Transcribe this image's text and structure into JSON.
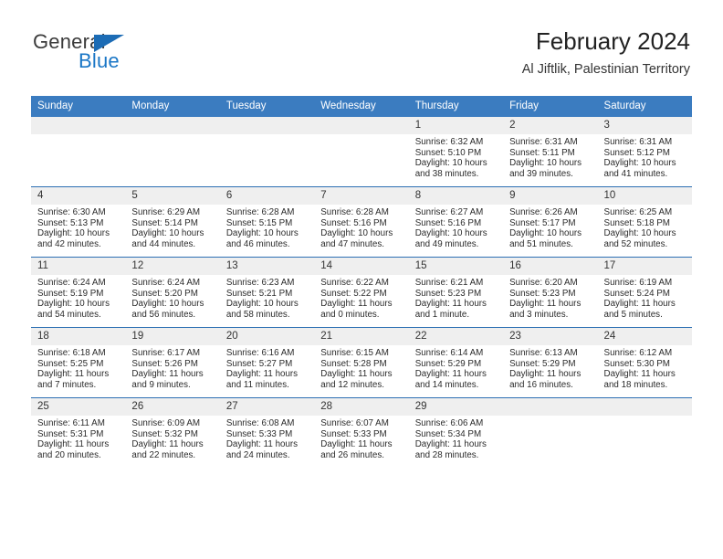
{
  "brand": {
    "name_top": "General",
    "name_bottom": "Blue",
    "color_top": "#3b3b3b",
    "color_bottom": "#1a76c6",
    "triangle_color": "#1c6cb5"
  },
  "header": {
    "title": "February 2024",
    "subtitle": "Al Jiftlik, Palestinian Territory"
  },
  "theme": {
    "header_bg": "#3b7cc0",
    "header_text": "#ffffff",
    "daynum_bg": "#efefef",
    "row_divider": "#2c6fb3"
  },
  "weekday_headers": [
    "Sunday",
    "Monday",
    "Tuesday",
    "Wednesday",
    "Thursday",
    "Friday",
    "Saturday"
  ],
  "weeks": [
    [
      {
        "day": "",
        "sunrise": "",
        "sunset": "",
        "daylight1": "",
        "daylight2": ""
      },
      {
        "day": "",
        "sunrise": "",
        "sunset": "",
        "daylight1": "",
        "daylight2": ""
      },
      {
        "day": "",
        "sunrise": "",
        "sunset": "",
        "daylight1": "",
        "daylight2": ""
      },
      {
        "day": "",
        "sunrise": "",
        "sunset": "",
        "daylight1": "",
        "daylight2": ""
      },
      {
        "day": "1",
        "sunrise": "Sunrise: 6:32 AM",
        "sunset": "Sunset: 5:10 PM",
        "daylight1": "Daylight: 10 hours",
        "daylight2": "and 38 minutes."
      },
      {
        "day": "2",
        "sunrise": "Sunrise: 6:31 AM",
        "sunset": "Sunset: 5:11 PM",
        "daylight1": "Daylight: 10 hours",
        "daylight2": "and 39 minutes."
      },
      {
        "day": "3",
        "sunrise": "Sunrise: 6:31 AM",
        "sunset": "Sunset: 5:12 PM",
        "daylight1": "Daylight: 10 hours",
        "daylight2": "and 41 minutes."
      }
    ],
    [
      {
        "day": "4",
        "sunrise": "Sunrise: 6:30 AM",
        "sunset": "Sunset: 5:13 PM",
        "daylight1": "Daylight: 10 hours",
        "daylight2": "and 42 minutes."
      },
      {
        "day": "5",
        "sunrise": "Sunrise: 6:29 AM",
        "sunset": "Sunset: 5:14 PM",
        "daylight1": "Daylight: 10 hours",
        "daylight2": "and 44 minutes."
      },
      {
        "day": "6",
        "sunrise": "Sunrise: 6:28 AM",
        "sunset": "Sunset: 5:15 PM",
        "daylight1": "Daylight: 10 hours",
        "daylight2": "and 46 minutes."
      },
      {
        "day": "7",
        "sunrise": "Sunrise: 6:28 AM",
        "sunset": "Sunset: 5:16 PM",
        "daylight1": "Daylight: 10 hours",
        "daylight2": "and 47 minutes."
      },
      {
        "day": "8",
        "sunrise": "Sunrise: 6:27 AM",
        "sunset": "Sunset: 5:16 PM",
        "daylight1": "Daylight: 10 hours",
        "daylight2": "and 49 minutes."
      },
      {
        "day": "9",
        "sunrise": "Sunrise: 6:26 AM",
        "sunset": "Sunset: 5:17 PM",
        "daylight1": "Daylight: 10 hours",
        "daylight2": "and 51 minutes."
      },
      {
        "day": "10",
        "sunrise": "Sunrise: 6:25 AM",
        "sunset": "Sunset: 5:18 PM",
        "daylight1": "Daylight: 10 hours",
        "daylight2": "and 52 minutes."
      }
    ],
    [
      {
        "day": "11",
        "sunrise": "Sunrise: 6:24 AM",
        "sunset": "Sunset: 5:19 PM",
        "daylight1": "Daylight: 10 hours",
        "daylight2": "and 54 minutes."
      },
      {
        "day": "12",
        "sunrise": "Sunrise: 6:24 AM",
        "sunset": "Sunset: 5:20 PM",
        "daylight1": "Daylight: 10 hours",
        "daylight2": "and 56 minutes."
      },
      {
        "day": "13",
        "sunrise": "Sunrise: 6:23 AM",
        "sunset": "Sunset: 5:21 PM",
        "daylight1": "Daylight: 10 hours",
        "daylight2": "and 58 minutes."
      },
      {
        "day": "14",
        "sunrise": "Sunrise: 6:22 AM",
        "sunset": "Sunset: 5:22 PM",
        "daylight1": "Daylight: 11 hours",
        "daylight2": "and 0 minutes."
      },
      {
        "day": "15",
        "sunrise": "Sunrise: 6:21 AM",
        "sunset": "Sunset: 5:23 PM",
        "daylight1": "Daylight: 11 hours",
        "daylight2": "and 1 minute."
      },
      {
        "day": "16",
        "sunrise": "Sunrise: 6:20 AM",
        "sunset": "Sunset: 5:23 PM",
        "daylight1": "Daylight: 11 hours",
        "daylight2": "and 3 minutes."
      },
      {
        "day": "17",
        "sunrise": "Sunrise: 6:19 AM",
        "sunset": "Sunset: 5:24 PM",
        "daylight1": "Daylight: 11 hours",
        "daylight2": "and 5 minutes."
      }
    ],
    [
      {
        "day": "18",
        "sunrise": "Sunrise: 6:18 AM",
        "sunset": "Sunset: 5:25 PM",
        "daylight1": "Daylight: 11 hours",
        "daylight2": "and 7 minutes."
      },
      {
        "day": "19",
        "sunrise": "Sunrise: 6:17 AM",
        "sunset": "Sunset: 5:26 PM",
        "daylight1": "Daylight: 11 hours",
        "daylight2": "and 9 minutes."
      },
      {
        "day": "20",
        "sunrise": "Sunrise: 6:16 AM",
        "sunset": "Sunset: 5:27 PM",
        "daylight1": "Daylight: 11 hours",
        "daylight2": "and 11 minutes."
      },
      {
        "day": "21",
        "sunrise": "Sunrise: 6:15 AM",
        "sunset": "Sunset: 5:28 PM",
        "daylight1": "Daylight: 11 hours",
        "daylight2": "and 12 minutes."
      },
      {
        "day": "22",
        "sunrise": "Sunrise: 6:14 AM",
        "sunset": "Sunset: 5:29 PM",
        "daylight1": "Daylight: 11 hours",
        "daylight2": "and 14 minutes."
      },
      {
        "day": "23",
        "sunrise": "Sunrise: 6:13 AM",
        "sunset": "Sunset: 5:29 PM",
        "daylight1": "Daylight: 11 hours",
        "daylight2": "and 16 minutes."
      },
      {
        "day": "24",
        "sunrise": "Sunrise: 6:12 AM",
        "sunset": "Sunset: 5:30 PM",
        "daylight1": "Daylight: 11 hours",
        "daylight2": "and 18 minutes."
      }
    ],
    [
      {
        "day": "25",
        "sunrise": "Sunrise: 6:11 AM",
        "sunset": "Sunset: 5:31 PM",
        "daylight1": "Daylight: 11 hours",
        "daylight2": "and 20 minutes."
      },
      {
        "day": "26",
        "sunrise": "Sunrise: 6:09 AM",
        "sunset": "Sunset: 5:32 PM",
        "daylight1": "Daylight: 11 hours",
        "daylight2": "and 22 minutes."
      },
      {
        "day": "27",
        "sunrise": "Sunrise: 6:08 AM",
        "sunset": "Sunset: 5:33 PM",
        "daylight1": "Daylight: 11 hours",
        "daylight2": "and 24 minutes."
      },
      {
        "day": "28",
        "sunrise": "Sunrise: 6:07 AM",
        "sunset": "Sunset: 5:33 PM",
        "daylight1": "Daylight: 11 hours",
        "daylight2": "and 26 minutes."
      },
      {
        "day": "29",
        "sunrise": "Sunrise: 6:06 AM",
        "sunset": "Sunset: 5:34 PM",
        "daylight1": "Daylight: 11 hours",
        "daylight2": "and 28 minutes."
      },
      {
        "day": "",
        "sunrise": "",
        "sunset": "",
        "daylight1": "",
        "daylight2": ""
      },
      {
        "day": "",
        "sunrise": "",
        "sunset": "",
        "daylight1": "",
        "daylight2": ""
      }
    ]
  ]
}
